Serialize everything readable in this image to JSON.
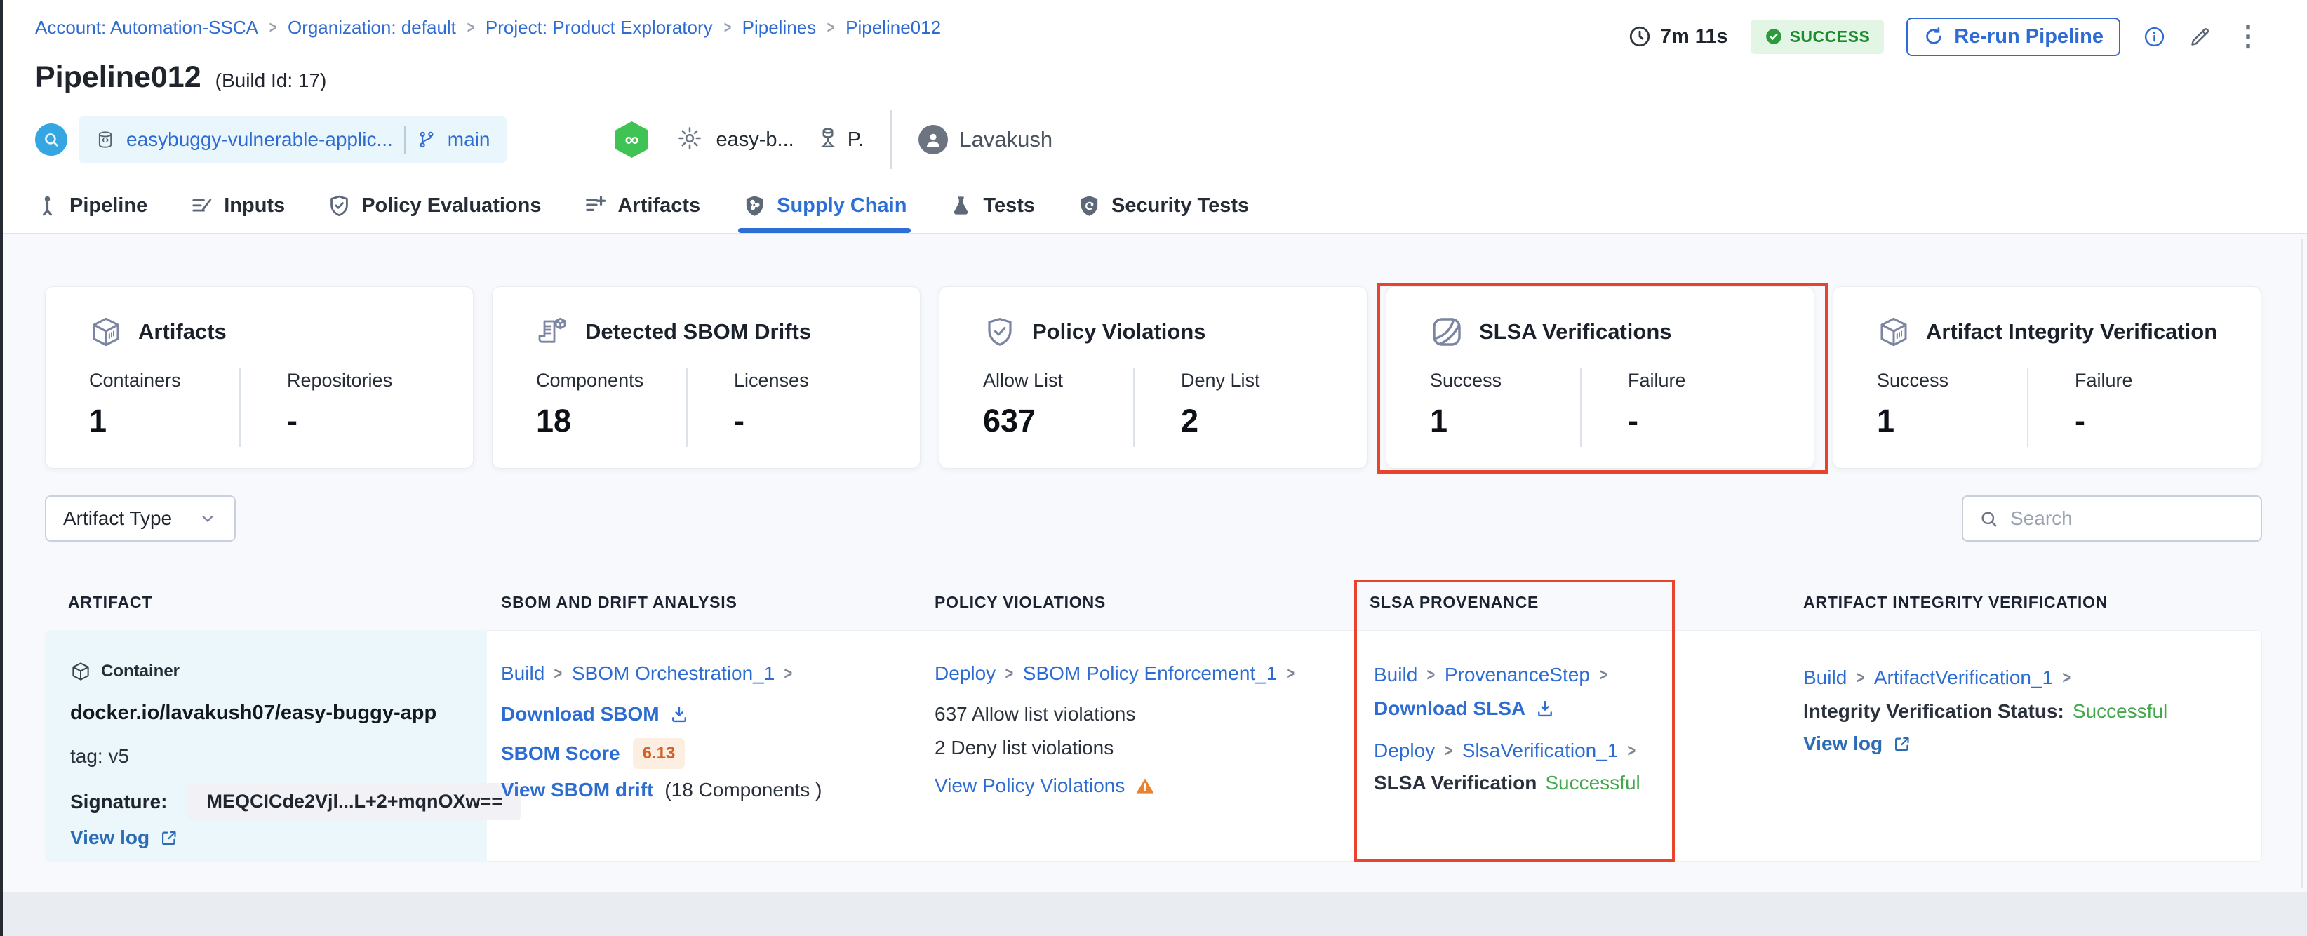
{
  "glyphs": {
    "chevron": ">",
    "kebab": "⋮",
    "infinity": "∞"
  },
  "breadcrumb": {
    "separator": ">",
    "items": [
      "Account: Automation-SSCA",
      "Organization: default",
      "Project: Product Exploratory",
      "Pipelines",
      "Pipeline012"
    ]
  },
  "topbar": {
    "duration": "7m 11s",
    "status": "SUCCESS",
    "rerun_label": "Re-run Pipeline"
  },
  "header": {
    "title": "Pipeline012",
    "build_id": "(Build Id: 17)",
    "repo_name": "easybuggy-vulnerable-applic...",
    "branch": "main",
    "config_ref": "easy-b...",
    "delegate_ref": "P.",
    "user_name": "Lavakush"
  },
  "tabs": [
    {
      "label": "Pipeline"
    },
    {
      "label": "Inputs"
    },
    {
      "label": "Policy Evaluations"
    },
    {
      "label": "Artifacts"
    },
    {
      "label": "Supply Chain"
    },
    {
      "label": "Tests"
    },
    {
      "label": "Security Tests"
    }
  ],
  "summary_cards": [
    {
      "title": "Artifacts",
      "icon": "cube-icon",
      "stats": [
        {
          "label": "Containers",
          "value": "1"
        },
        {
          "label": "Repositories",
          "value": "-"
        }
      ]
    },
    {
      "title": "Detected SBOM Drifts",
      "icon": "sbom-scroll-icon",
      "stats": [
        {
          "label": "Components",
          "value": "18"
        },
        {
          "label": "Licenses",
          "value": "-"
        }
      ]
    },
    {
      "title": "Policy Violations",
      "icon": "shield-check-icon",
      "stats": [
        {
          "label": "Allow List",
          "value": "637"
        },
        {
          "label": "Deny List",
          "value": "2"
        }
      ]
    },
    {
      "title": "SLSA Verifications",
      "icon": "slsa-icon",
      "highlighted": true,
      "stats": [
        {
          "label": "Success",
          "value": "1"
        },
        {
          "label": "Failure",
          "value": "-"
        }
      ]
    },
    {
      "title": "Artifact Integrity Verification",
      "icon": "cube-icon",
      "stats": [
        {
          "label": "Success",
          "value": "1"
        },
        {
          "label": "Failure",
          "value": "-"
        }
      ]
    }
  ],
  "filters": {
    "artifact_type_label": "Artifact Type",
    "search_placeholder": "Search"
  },
  "table": {
    "headers": [
      "ARTIFACT",
      "SBOM AND DRIFT ANALYSIS",
      "POLICY VIOLATIONS",
      "SLSA PROVENANCE",
      "ARTIFACT INTEGRITY VERIFICATION"
    ],
    "row": {
      "artifact": {
        "type_label": "Container",
        "image": "docker.io/lavakush07/easy-buggy-app",
        "tag": "tag: v5",
        "signature_label": "Signature:",
        "signature_value": "MEQCICde2Vjl...L+2+mqnOXw==",
        "view_log_label": "View log"
      },
      "sbom": {
        "stage": "Build",
        "step": "SBOM Orchestration_1",
        "download_label": "Download SBOM",
        "score_label": "SBOM Score",
        "score_value": "6.13",
        "drift_link": "View SBOM drift",
        "drift_note": "(18 Components )"
      },
      "policy": {
        "stage": "Deploy",
        "step": "SBOM Policy Enforcement_1",
        "allow_text": "637 Allow list violations",
        "deny_text": "2 Deny list violations",
        "view_label": "View Policy Violations"
      },
      "slsa": {
        "stage1": "Build",
        "step1": "ProvenanceStep",
        "download_label": "Download SLSA",
        "stage2": "Deploy",
        "step2": "SlsaVerification_1",
        "status_label": "SLSA Verification",
        "status_value": "Successful"
      },
      "integrity": {
        "stage": "Build",
        "step": "ArtifactVerification_1",
        "status_label": "Integrity Verification Status:",
        "status_value": "Successful",
        "view_log_label": "View log"
      }
    }
  },
  "colors": {
    "brand_blue": "#2e6bd3",
    "active_tab_blue": "#2e6fd6",
    "link_blue": "#2d6dd2",
    "view_log_blue": "#2b6cb4",
    "success_text_green": "#43a84c",
    "status_badge_text": "#1d8a2f",
    "status_badge_bg": "#e3f6e5",
    "sbom_score_text": "#d2622a",
    "sbom_score_bg": "#fcefe2",
    "annotation_red": "#e8432c",
    "artifact_cell_bg": "#ebf7fb",
    "trigger_icon_bg": "#36a6e2",
    "ci_hex_green": "#3fc354"
  }
}
